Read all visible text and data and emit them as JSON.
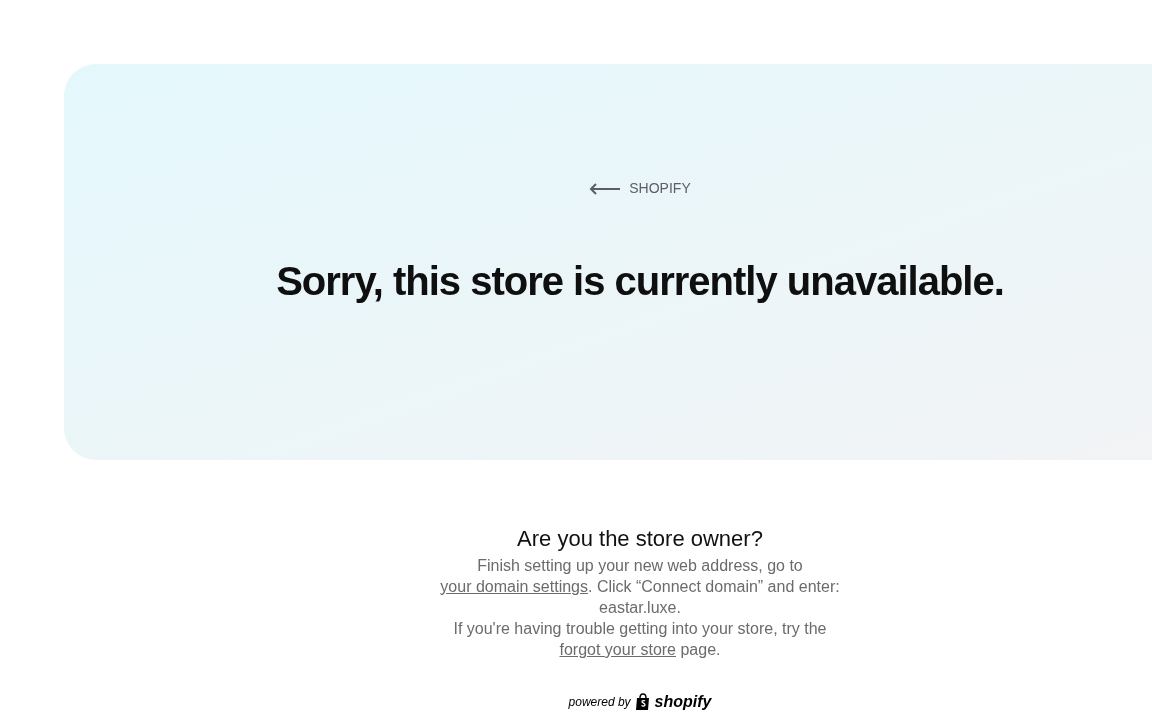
{
  "back_link": {
    "label": "SHOPIFY"
  },
  "heading": "Sorry, this store is currently unavailable.",
  "owner_section": {
    "title": "Are you the store owner?",
    "paragraphs": [
      {
        "parts": [
          {
            "kind": "text",
            "text": "Finish setting up your new web address, go to "
          },
          {
            "kind": "link",
            "text": "your domain settings"
          },
          {
            "kind": "text",
            "text": ". Click “Connect domain” and enter: eastar.luxe."
          }
        ]
      },
      {
        "parts": [
          {
            "kind": "text",
            "text": "If you're having trouble getting into your store, try the "
          },
          {
            "kind": "link",
            "text": "forgot your store"
          },
          {
            "kind": "text",
            "text": " page."
          }
        ]
      }
    ]
  },
  "footer": {
    "prefix": "powered by",
    "brand": "shopify"
  }
}
